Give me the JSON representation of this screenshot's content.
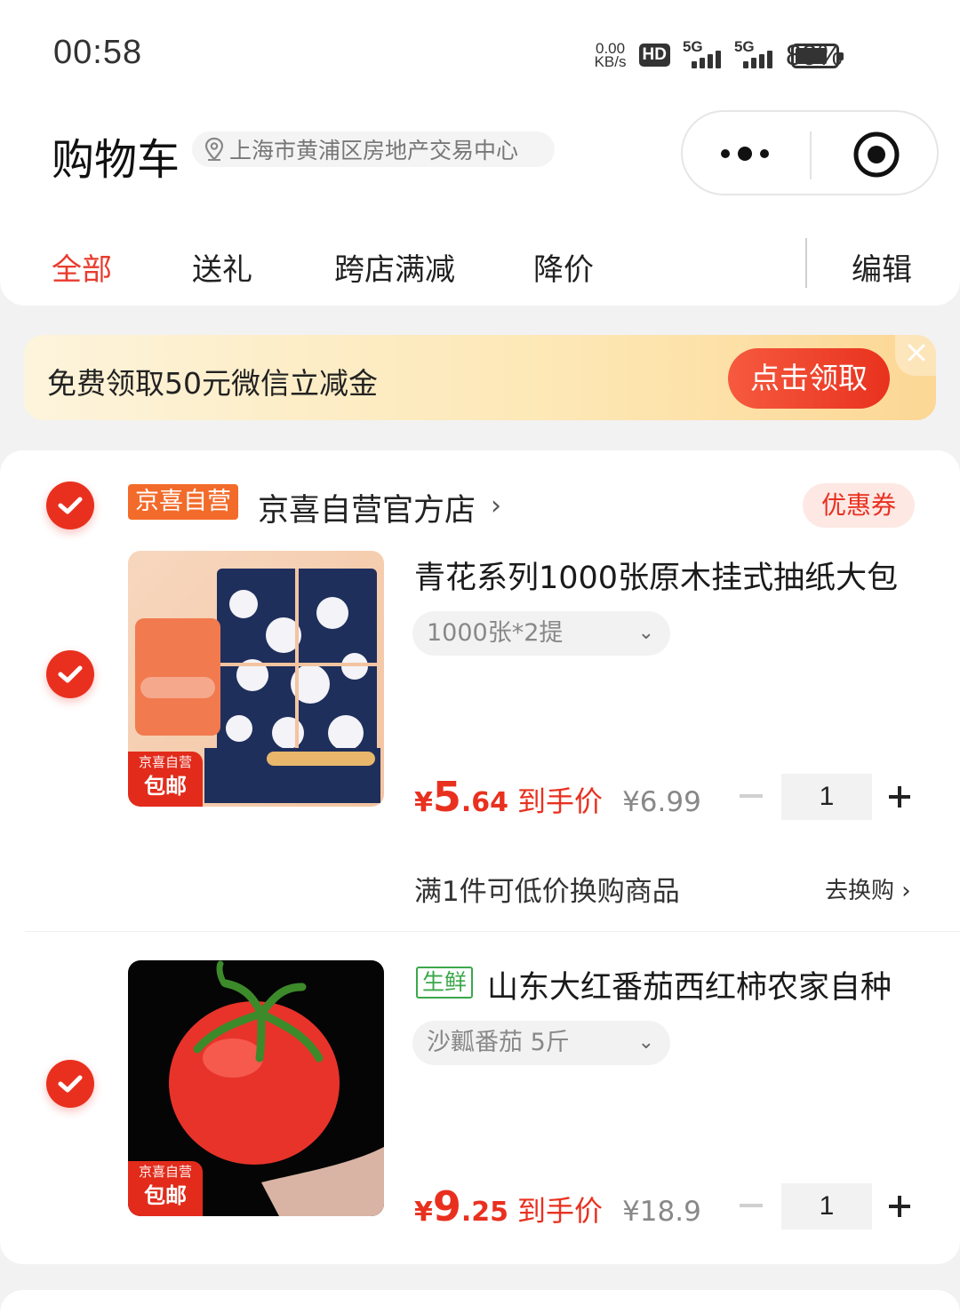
{
  "status_bar": {
    "time": "00:58",
    "net_speed_top": "0.00",
    "net_speed_bottom": "KB/s",
    "hd": "HD",
    "signal_1": "5G",
    "signal_2": "5G",
    "battery": "80%",
    "battery_level": 0.8
  },
  "header": {
    "title": "购物车",
    "location": "上海市黄浦区房地产交易中心"
  },
  "tabs": [
    {
      "label": "全部",
      "active": true
    },
    {
      "label": "送礼",
      "active": false
    },
    {
      "label": "跨店满减",
      "active": false
    },
    {
      "label": "降价",
      "active": false
    }
  ],
  "edit_label": "编辑",
  "banner": {
    "message": "免费领取50元微信立减金",
    "button": "点击领取"
  },
  "store": {
    "tag": "京喜自营",
    "name": "京喜自营官方店",
    "coupon": "优惠券"
  },
  "items": [
    {
      "title": "青花系列1000张原木挂式抽纸大包",
      "spec": "1000张*2提",
      "price_currency": "¥",
      "price_int": "5",
      "price_dec": ".64",
      "price_label": "到手价",
      "original_price": "¥6.99",
      "quantity": "1",
      "badge_top": "京喜自营",
      "badge_bottom": "包邮"
    },
    {
      "tag": "生鲜",
      "title": "山东大红番茄西红柿农家自种",
      "spec": "沙瓤番茄 5斤",
      "price_currency": "¥",
      "price_int": "9",
      "price_dec": ".25",
      "price_label": "到手价",
      "original_price": "¥18.9",
      "quantity": "1",
      "badge_top": "京喜自营",
      "badge_bottom": "包邮"
    }
  ],
  "swap": {
    "text": "满1件可低价换购商品",
    "link": "去换购"
  },
  "colors": {
    "accent": "#e9301f",
    "fresh": "#3ba84a",
    "store_tag": "#f26b2a"
  }
}
